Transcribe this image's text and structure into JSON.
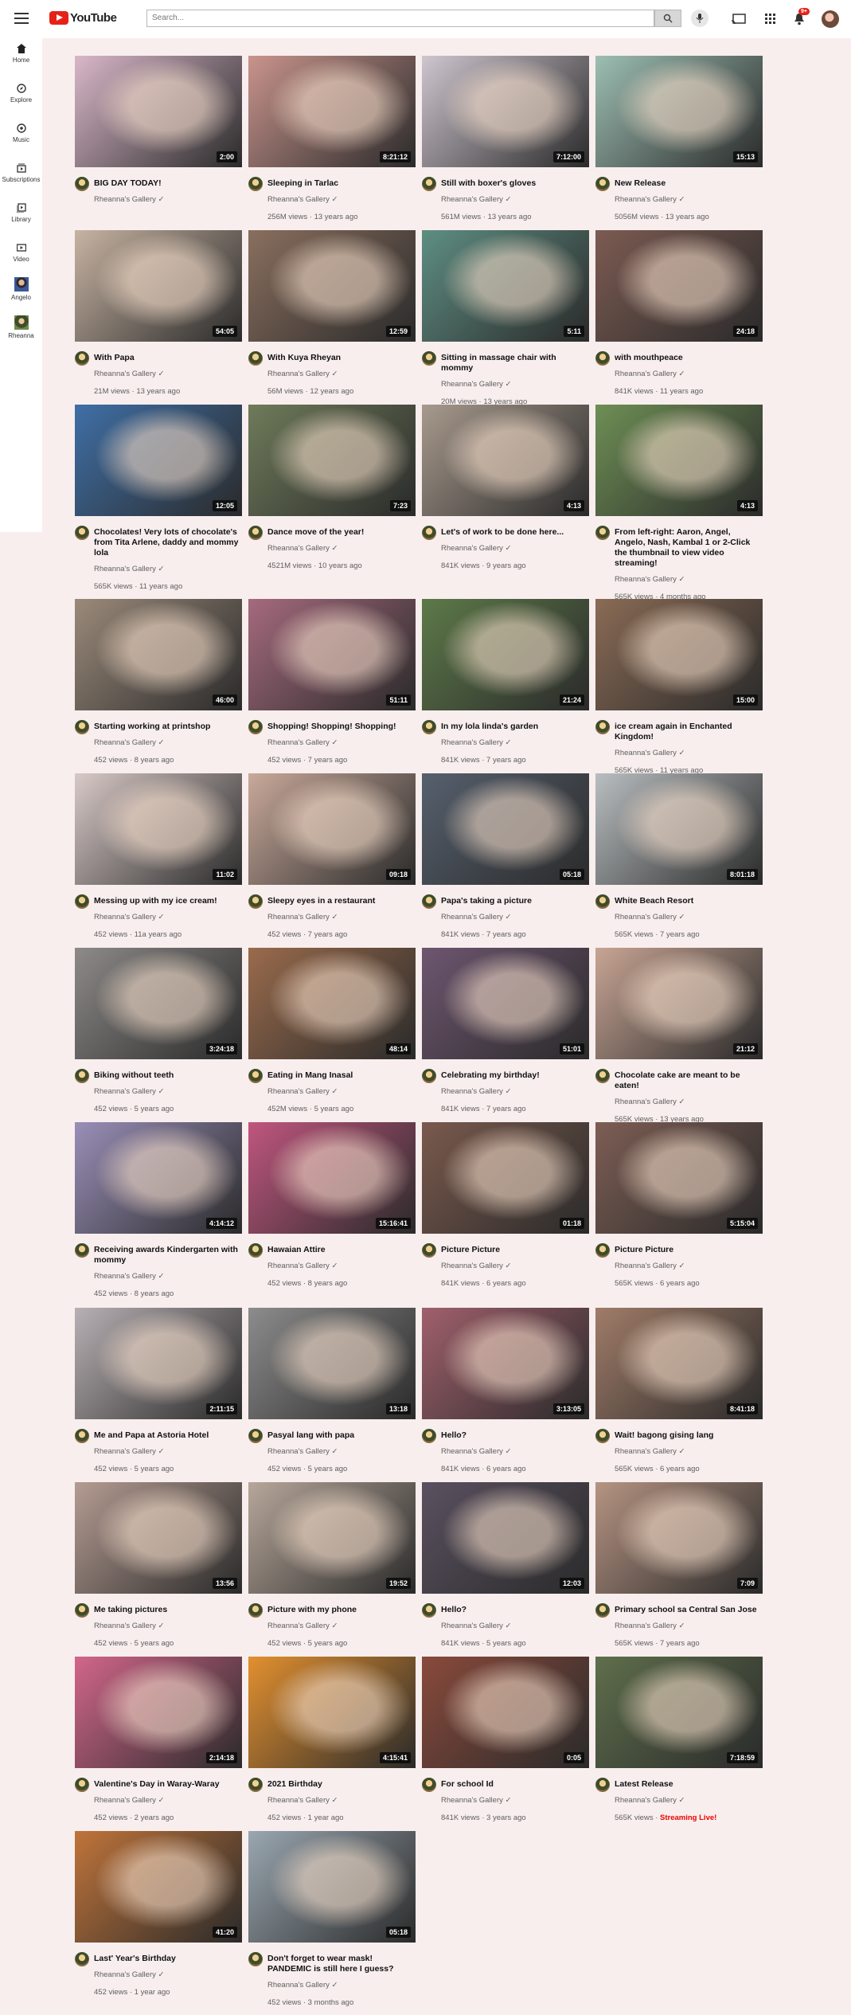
{
  "header": {
    "logo_text": "YouTube",
    "search_placeholder": "Search...",
    "notification_count": "9+",
    "accent_color": "#e62117"
  },
  "sidebar": {
    "items": [
      {
        "label": "Home",
        "icon": "home-icon"
      },
      {
        "label": "Explore",
        "icon": "compass-icon"
      },
      {
        "label": "Music",
        "icon": "music-icon"
      },
      {
        "label": "Subscriptions",
        "icon": "subscriptions-icon"
      },
      {
        "label": "Library",
        "icon": "library-icon"
      },
      {
        "label": "Video",
        "icon": "video-icon"
      },
      {
        "label": "Angelo",
        "icon": "avatar"
      },
      {
        "label": "Rheanna",
        "icon": "avatar"
      }
    ]
  },
  "videos": [
    {
      "title": "BIG DAY TODAY!",
      "channel": "Rheanna's Gallery ✓",
      "stats": "",
      "duration": "2:00",
      "thumb": "#d9b7c9"
    },
    {
      "title": "Sleeping in Tarlac",
      "channel": "Rheanna's Gallery ✓",
      "stats": "256M views · 13 years ago",
      "duration": "8:21:12",
      "thumb": "#c9948c"
    },
    {
      "title": "Still with boxer's gloves",
      "channel": "Rheanna's Gallery ✓",
      "stats": "561M views · 13 years ago",
      "duration": "7:12:00",
      "thumb": "#cfc6cf"
    },
    {
      "title": "New Release",
      "channel": "Rheanna's Gallery ✓",
      "stats": "5056M views · 13 years ago",
      "duration": "15:13",
      "thumb": "#9dbfb3"
    },
    {
      "title": "With Papa",
      "channel": "Rheanna's Gallery ✓",
      "stats": "21M views · 13 years ago",
      "duration": "54:05",
      "thumb": "#c7b3a2"
    },
    {
      "title": "With Kuya Rheyan",
      "channel": "Rheanna's Gallery ✓",
      "stats": "56M views · 12 years ago",
      "duration": "12:59",
      "thumb": "#8a6f5e"
    },
    {
      "title": "Sitting in massage chair with mommy",
      "channel": "Rheanna's Gallery ✓",
      "stats": "20M views · 13 years ago",
      "duration": "5:11",
      "thumb": "#5e8e82"
    },
    {
      "title": "with mouthpeace",
      "channel": "Rheanna's Gallery ✓",
      "stats": "841K views · 11 years ago",
      "duration": "24:18",
      "thumb": "#7c5b52"
    },
    {
      "title": "Chocolates! Very lots of chocolate's from Tita Arlene, daddy and mommy lola",
      "channel": "Rheanna's Gallery ✓",
      "stats": "565K views · 11 years ago",
      "duration": "12:05",
      "thumb": "#3f6fa6"
    },
    {
      "title": "Dance move of the year!",
      "channel": "Rheanna's Gallery ✓",
      "stats": "4521M views · 10 years ago",
      "duration": "7:23",
      "thumb": "#6f7b5a"
    },
    {
      "title": "Let's of work to be done here...",
      "channel": "Rheanna's Gallery ✓",
      "stats": "841K views · 9 years ago",
      "duration": "4:13",
      "thumb": "#a89a8d"
    },
    {
      "title": "From left-right: Aaron, Angel, Angelo, Nash, Kambal 1 or 2-Click the thumbnail to view video streaming!",
      "channel": "Rheanna's Gallery ✓",
      "stats": "565K views · 4 months ago",
      "duration": "4:13",
      "thumb": "#6e8f55"
    },
    {
      "title": "Starting working at printshop",
      "channel": "Rheanna's Gallery ✓",
      "stats": "452 views · 8 years ago",
      "duration": "46:00",
      "thumb": "#9b8a7a"
    },
    {
      "title": "Shopping! Shopping! Shopping!",
      "channel": "Rheanna's Gallery ✓",
      "stats": "452 views · 7 years ago",
      "duration": "51:11",
      "thumb": "#a56a7e"
    },
    {
      "title": "In my lola linda's garden",
      "channel": "Rheanna's Gallery ✓",
      "stats": "841K views · 7 years ago",
      "duration": "21:24",
      "thumb": "#5d7a49"
    },
    {
      "title": "ice cream again in Enchanted Kingdom!",
      "channel": "Rheanna's Gallery ✓",
      "stats": "565K views · 11 years ago",
      "duration": "15:00",
      "thumb": "#8a6b55"
    },
    {
      "title": "Messing up with my ice cream!",
      "channel": "Rheanna's Gallery ✓",
      "stats": "452 views · 11a years ago",
      "duration": "11:02",
      "thumb": "#d8c9c7"
    },
    {
      "title": "Sleepy eyes in a restaurant",
      "channel": "Rheanna's Gallery ✓",
      "stats": "452 views · 7 years ago",
      "duration": "09:18",
      "thumb": "#c9a99a"
    },
    {
      "title": "Papa's taking a picture",
      "channel": "Rheanna's Gallery ✓",
      "stats": "841K views · 7 years ago",
      "duration": "05:18",
      "thumb": "#56606e"
    },
    {
      "title": "White Beach Resort",
      "channel": "Rheanna's Gallery ✓",
      "stats": "565K views · 7 years ago",
      "duration": "8:01:18",
      "thumb": "#b9bec0"
    },
    {
      "title": "Biking without teeth",
      "channel": "Rheanna's Gallery ✓",
      "stats": "452 views · 5 years ago",
      "duration": "3:24:18",
      "thumb": "#8d8a88"
    },
    {
      "title": "Eating in Mang Inasal",
      "channel": "Rheanna's Gallery ✓",
      "stats": "452M views · 5 years ago",
      "duration": "48:14",
      "thumb": "#9a6b4c"
    },
    {
      "title": "Celebrating my birthday!",
      "channel": "Rheanna's Gallery ✓",
      "stats": "841K views · 7 years ago",
      "duration": "51:01",
      "thumb": "#6e5670"
    },
    {
      "title": "Chocolate cake are meant to be eaten!",
      "channel": "Rheanna's Gallery ✓",
      "stats": "565K views · 13 years ago",
      "duration": "21:12",
      "thumb": "#c8a594"
    },
    {
      "title": "Receiving awards Kindergarten with mommy",
      "channel": "Rheanna's Gallery ✓",
      "stats": "452 views · 8 years ago",
      "duration": "4:14:12",
      "thumb": "#9a8fb8"
    },
    {
      "title": "Hawaian Attire",
      "channel": "Rheanna's Gallery ✓",
      "stats": "452 views · 8 years ago",
      "duration": "15:16:41",
      "thumb": "#c0567e"
    },
    {
      "title": "Picture Picture",
      "channel": "Rheanna's Gallery ✓",
      "stats": "841K views · 6 years ago",
      "duration": "01:18",
      "thumb": "#7a5a4d"
    },
    {
      "title": "Picture Picture",
      "channel": "Rheanna's Gallery ✓",
      "stats": "565K views · 6 years ago",
      "duration": "5:15:04",
      "thumb": "#7d5e54"
    },
    {
      "title": "Me and Papa at Astoria Hotel",
      "channel": "Rheanna's Gallery ✓",
      "stats": "452 views · 5 years ago",
      "duration": "2:11:15",
      "thumb": "#b8b0b4"
    },
    {
      "title": "Pasyal lang with papa",
      "channel": "Rheanna's Gallery ✓",
      "stats": "452 views · 5 years ago",
      "duration": "13:18",
      "thumb": "#8c8c8c"
    },
    {
      "title": "Hello?",
      "channel": "Rheanna's Gallery ✓",
      "stats": "841K views · 6 years ago",
      "duration": "3:13:05",
      "thumb": "#a0606c"
    },
    {
      "title": "Wait! bagong gising lang",
      "channel": "Rheanna's Gallery ✓",
      "stats": "565K views · 6 years ago",
      "duration": "8:41:18",
      "thumb": "#a07c68"
    },
    {
      "title": "Me taking pictures",
      "channel": "Rheanna's Gallery ✓",
      "stats": "452 views · 5 years ago",
      "duration": "13:56",
      "thumb": "#b59c92"
    },
    {
      "title": "Picture with my phone",
      "channel": "Rheanna's Gallery ✓",
      "stats": "452 views · 5 years ago",
      "duration": "19:52",
      "thumb": "#b7a79a"
    },
    {
      "title": "Hello?",
      "channel": "Rheanna's Gallery ✓",
      "stats": "841K views · 5 years ago",
      "duration": "12:03",
      "thumb": "#5a5160"
    },
    {
      "title": "Primary school sa Central San Jose",
      "channel": "Rheanna's Gallery ✓",
      "stats": "565K views · 7 years ago",
      "duration": "7:09",
      "thumb": "#b69482"
    },
    {
      "title": "Valentine's Day in Waray-Waray",
      "channel": "Rheanna's Gallery ✓",
      "stats": "452 views · 2 years ago",
      "duration": "2:14:18",
      "thumb": "#d2668b"
    },
    {
      "title": "2021 Birthday",
      "channel": "Rheanna's Gallery ✓",
      "stats": "452 views · 1 year ago",
      "duration": "4:15:41",
      "thumb": "#e3902f"
    },
    {
      "title": "For school Id",
      "channel": "Rheanna's Gallery ✓",
      "stats": "841K views · 3 years ago",
      "duration": "0:05",
      "thumb": "#8a4a3c"
    },
    {
      "title": "Latest Release",
      "channel": "Rheanna's Gallery ✓",
      "stats": "565K views · ",
      "live": "Streaming Live!",
      "duration": "7:18:59",
      "thumb": "#5f6f4c"
    },
    {
      "title": "Last' Year's Birthday",
      "channel": "Rheanna's Gallery ✓",
      "stats": "452 views · 1 year ago",
      "duration": "41:20",
      "thumb": "#c0743a"
    },
    {
      "title": "Don't forget to wear mask! PANDEMIC is still here I guess?",
      "channel": "Rheanna's Gallery ✓",
      "stats": "452 views · 3 months ago",
      "duration": "05:18",
      "thumb": "#9aa7b1"
    }
  ]
}
